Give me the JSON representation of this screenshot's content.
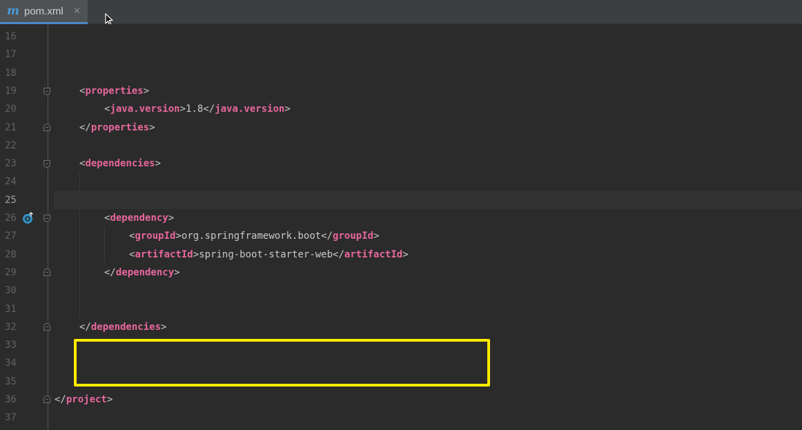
{
  "tab": {
    "icon_letter": "m",
    "label": "pom.xml",
    "close_glyph": "✕"
  },
  "colors": {
    "tag": "#e8679d",
    "highlight": "#ffea00",
    "accent": "#4a88c7"
  },
  "editor": {
    "lines": [
      {
        "num": "16",
        "tokens": []
      },
      {
        "num": "17",
        "tokens": []
      },
      {
        "num": "18",
        "tokens": []
      },
      {
        "num": "19",
        "indent": 1,
        "fold": "open",
        "tokens": [
          [
            "punc",
            "<"
          ],
          [
            "tag",
            "properties"
          ],
          [
            "punc",
            ">"
          ]
        ]
      },
      {
        "num": "20",
        "indent": 2,
        "tokens": [
          [
            "punc",
            "<"
          ],
          [
            "tag",
            "java.version"
          ],
          [
            "punc",
            ">"
          ],
          [
            "val",
            "1.8"
          ],
          [
            "punc",
            "</"
          ],
          [
            "tag",
            "java.version"
          ],
          [
            "punc",
            ">"
          ]
        ]
      },
      {
        "num": "21",
        "indent": 1,
        "fold": "close",
        "tokens": [
          [
            "punc",
            "</"
          ],
          [
            "tag",
            "properties"
          ],
          [
            "punc",
            ">"
          ]
        ]
      },
      {
        "num": "22",
        "tokens": []
      },
      {
        "num": "23",
        "indent": 1,
        "fold": "open",
        "tokens": [
          [
            "punc",
            "<"
          ],
          [
            "tag",
            "dependencies"
          ],
          [
            "punc",
            ">"
          ]
        ]
      },
      {
        "num": "24",
        "tokens": []
      },
      {
        "num": "25",
        "current": true,
        "tokens": []
      },
      {
        "num": "26",
        "indent": 2,
        "fold": "open",
        "icon": "maven-dependency-icon",
        "tokens": [
          [
            "punc",
            "<"
          ],
          [
            "tag",
            "dependency"
          ],
          [
            "punc",
            ">"
          ]
        ]
      },
      {
        "num": "27",
        "indent": 3,
        "tokens": [
          [
            "punc",
            "<"
          ],
          [
            "tag",
            "groupId"
          ],
          [
            "punc",
            ">"
          ],
          [
            "val",
            "org.springframework.boot"
          ],
          [
            "punc",
            "</"
          ],
          [
            "tag",
            "groupId"
          ],
          [
            "punc",
            ">"
          ]
        ]
      },
      {
        "num": "28",
        "indent": 3,
        "tokens": [
          [
            "punc",
            "<"
          ],
          [
            "tag",
            "artifactId"
          ],
          [
            "punc",
            ">"
          ],
          [
            "val",
            "spring-boot-starter-web"
          ],
          [
            "punc",
            "</"
          ],
          [
            "tag",
            "artifactId"
          ],
          [
            "punc",
            ">"
          ]
        ]
      },
      {
        "num": "29",
        "indent": 2,
        "fold": "close",
        "tokens": [
          [
            "punc",
            "</"
          ],
          [
            "tag",
            "dependency"
          ],
          [
            "punc",
            ">"
          ]
        ]
      },
      {
        "num": "30",
        "tokens": []
      },
      {
        "num": "31",
        "tokens": []
      },
      {
        "num": "32",
        "indent": 1,
        "fold": "close",
        "tokens": [
          [
            "punc",
            "</"
          ],
          [
            "tag",
            "dependencies"
          ],
          [
            "punc",
            ">"
          ]
        ]
      },
      {
        "num": "33",
        "tokens": []
      },
      {
        "num": "34",
        "tokens": []
      },
      {
        "num": "35",
        "tokens": []
      },
      {
        "num": "36",
        "indent": 0,
        "fold": "close",
        "tokens": [
          [
            "punc",
            "</"
          ],
          [
            "tag",
            "project"
          ],
          [
            "punc",
            ">"
          ]
        ]
      },
      {
        "num": "37",
        "tokens": []
      }
    ]
  }
}
